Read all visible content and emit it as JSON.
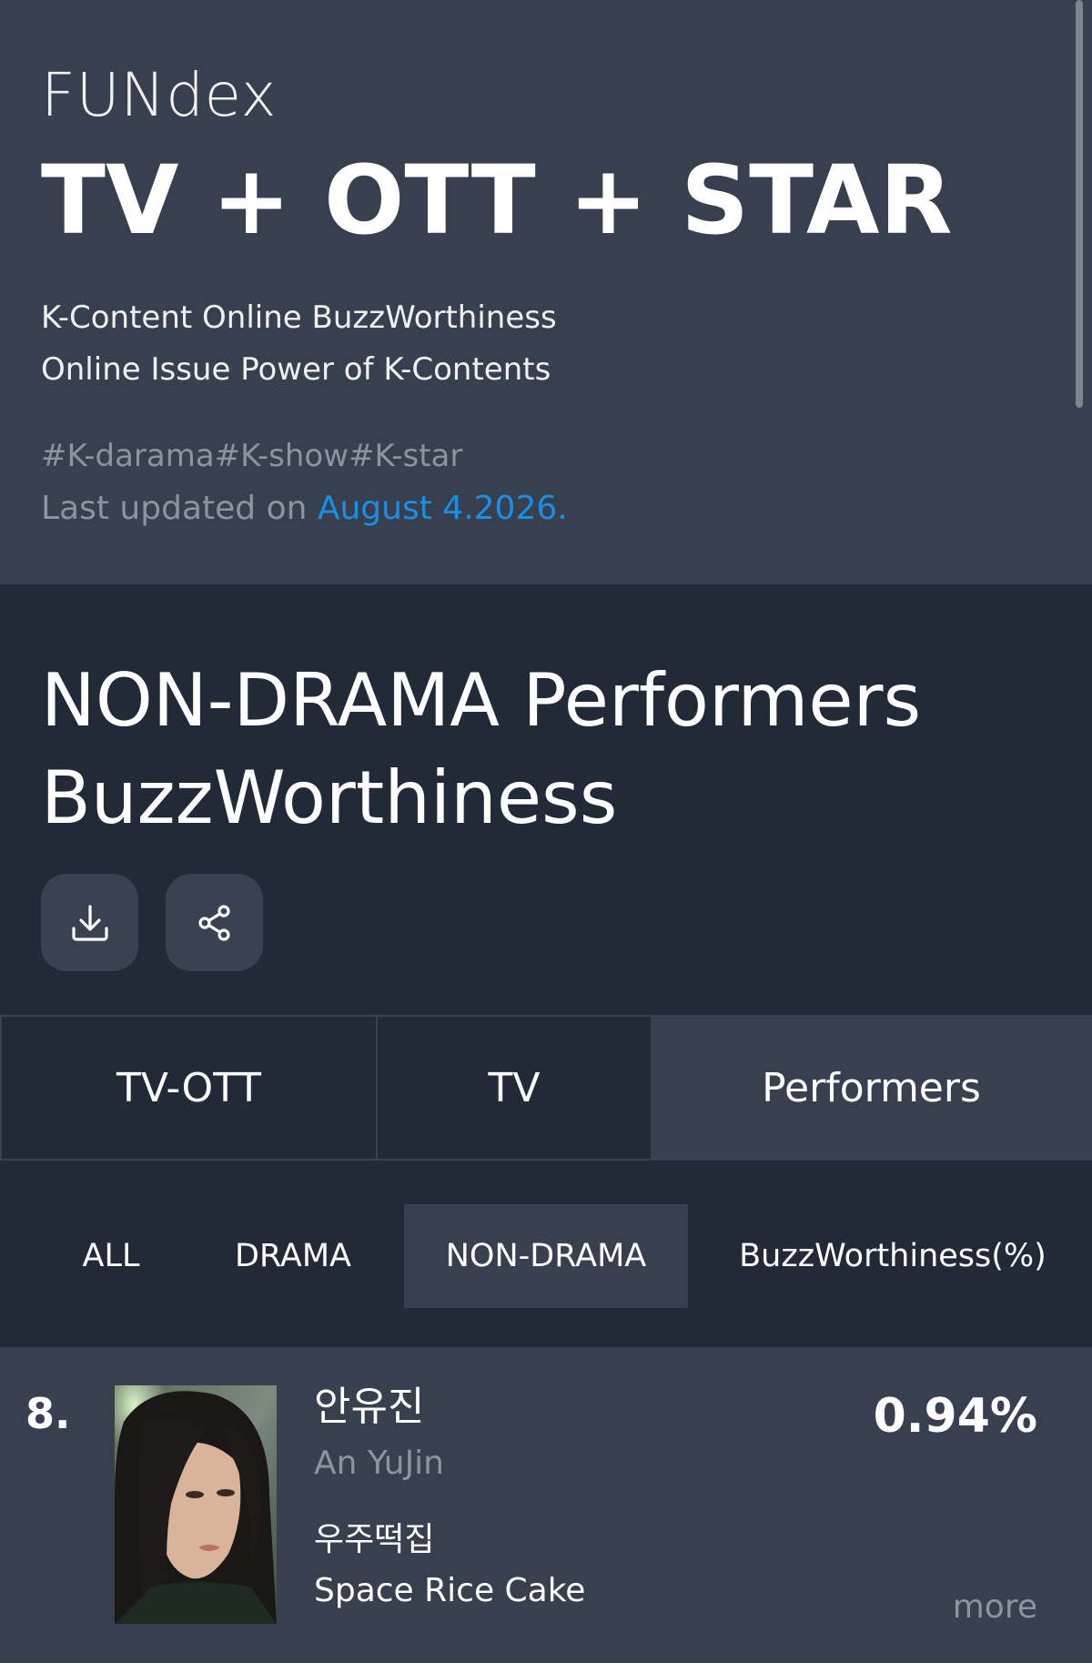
{
  "header": {
    "brand": "FUNdex",
    "headline": "TV + OTT + STAR",
    "description_line1": "K-Content Online BuzzWorthiness",
    "description_line2": "Online Issue Power of K-Contents",
    "hashtags": "#K-darama#K-show#K-star",
    "updated_prefix": "Last updated on ",
    "updated_date": "August 4.2026."
  },
  "section": {
    "title_line1": "NON-DRAMA Performers",
    "title_line2": "BuzzWorthiness",
    "download_icon": "download-icon",
    "share_icon": "share-icon"
  },
  "tabs": [
    {
      "label": "TV-OTT",
      "active": false
    },
    {
      "label": "TV",
      "active": false
    },
    {
      "label": "Performers",
      "active": true
    }
  ],
  "subtabs": [
    {
      "label": "ALL",
      "active": false
    },
    {
      "label": "DRAMA",
      "active": false
    },
    {
      "label": "NON-DRAMA",
      "active": true
    },
    {
      "label": "BuzzWorthiness(%)",
      "active": false
    }
  ],
  "entries": [
    {
      "rank": "8.",
      "name_ko": "안유진",
      "name_en": "An YuJin",
      "show_ko": "우주떡집",
      "show_en": "Space Rice Cake",
      "percent": "0.94%",
      "more_label": "more"
    }
  ],
  "colors": {
    "header_bg": "#383f4f",
    "page_bg": "#222a38",
    "accent_date": "#1a8fe3",
    "muted_text": "#8d93a0"
  }
}
